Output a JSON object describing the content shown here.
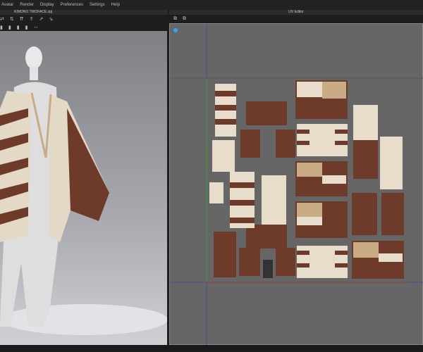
{
  "menu": [
    "Avatar",
    "Render",
    "Display",
    "Preferences",
    "Settings",
    "Help"
  ],
  "left_panel": {
    "title": "KIMONO TWOFACE.zpj"
  },
  "right_panel": {
    "title": "UV Editor"
  },
  "toolbar_left_row1": [
    "⇄",
    "⇅",
    "⇈",
    "⇑",
    "⇗",
    "⇘"
  ],
  "toolbar_left_row2": [
    "▮",
    "▮",
    "▮",
    "▮",
    "↔"
  ],
  "toolbar_uv": [
    "⧉",
    "⧉"
  ],
  "colors": {
    "fabric_brown": "#6e3b2a",
    "fabric_cream": "#e8dccb",
    "fabric_tan": "#c9ab86",
    "uv_bg": "#666666"
  }
}
